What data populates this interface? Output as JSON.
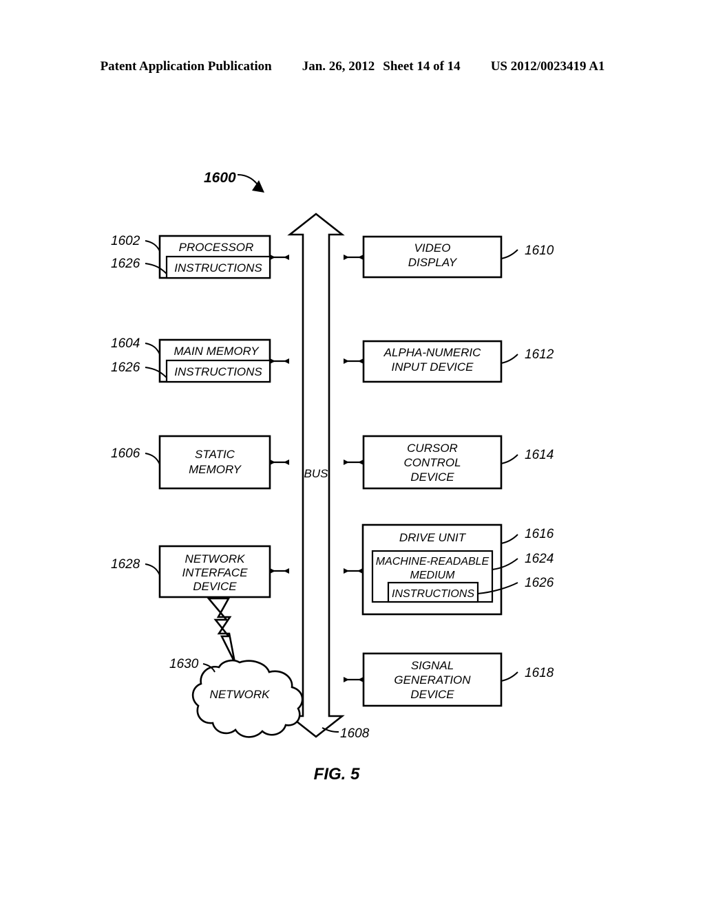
{
  "header": {
    "publication": "Patent Application Publication",
    "date": "Jan. 26, 2012",
    "sheet": "Sheet 14 of 14",
    "patent_number": "US 2012/0023419 A1"
  },
  "figure": {
    "caption": "FIG. 5",
    "system_ref": "1600",
    "bus_label": "BUS",
    "bus_ref": "1608"
  },
  "blocks": {
    "processor": {
      "label": "PROCESSOR",
      "ref": "1602",
      "inner_label": "INSTRUCTIONS",
      "inner_ref": "1626"
    },
    "main_memory": {
      "label": "MAIN MEMORY",
      "ref": "1604",
      "inner_label": "INSTRUCTIONS",
      "inner_ref": "1626"
    },
    "static_memory": {
      "line1": "STATIC",
      "line2": "MEMORY",
      "ref": "1606"
    },
    "network_interface": {
      "line1": "NETWORK",
      "line2": "INTERFACE",
      "line3": "DEVICE",
      "ref": "1628"
    },
    "network_cloud": {
      "label": "NETWORK",
      "ref": "1630"
    },
    "video_display": {
      "line1": "VIDEO",
      "line2": "DISPLAY",
      "ref": "1610"
    },
    "alpha_numeric_input": {
      "line1": "ALPHA-NUMERIC",
      "line2": "INPUT DEVICE",
      "ref": "1612"
    },
    "cursor_control": {
      "line1": "CURSOR",
      "line2": "CONTROL",
      "line3": "DEVICE",
      "ref": "1614"
    },
    "drive_unit": {
      "label": "DRIVE UNIT",
      "ref": "1616",
      "medium_line1": "MACHINE-READABLE",
      "medium_line2": "MEDIUM",
      "medium_ref": "1624",
      "instructions_label": "INSTRUCTIONS",
      "instructions_ref": "1626"
    },
    "signal_generation": {
      "line1": "SIGNAL",
      "line2": "GENERATION",
      "line3": "DEVICE",
      "ref": "1618"
    }
  },
  "colors": {
    "ink": "#000000",
    "paper": "#ffffff"
  }
}
